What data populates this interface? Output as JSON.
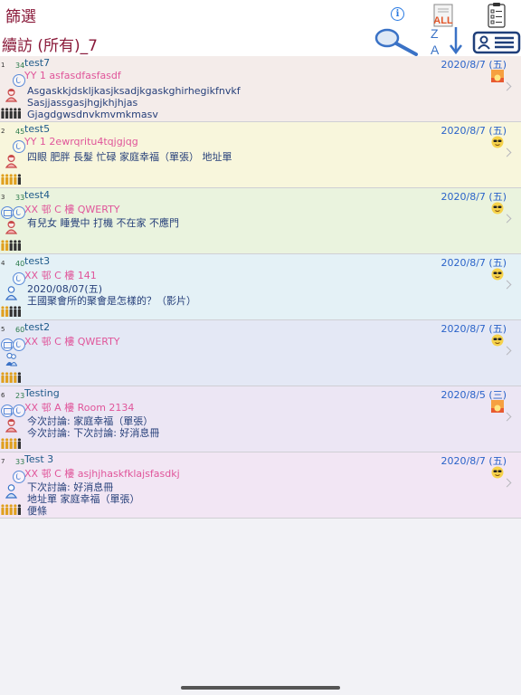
{
  "header": {
    "filter_label": "篩選",
    "title": "續訪 (所有)_7",
    "all_label": "ALL",
    "info_label": "i",
    "sort_letters": "Z A"
  },
  "colors": {
    "title": "#8a1a3a",
    "date": "#2a63c9",
    "address": "#e0559a",
    "notes": "#27407a"
  },
  "rows": [
    {
      "index": "1",
      "count": "34",
      "name": "test7",
      "date": "2020/8/7 (五)",
      "address": "YY 1 asfasdfasfasdf",
      "notes": [
        "Asgaskkjdskljkasjksadjkgaskghirhegikfnvkf",
        "Sasjjassgasjhgjkhjhjas",
        "Gjagdgwsdnvkmvmkmasv"
      ],
      "bg": "#f4ecea",
      "status_icon": "sunrise-icon",
      "contact": "phone",
      "person": "female",
      "people": "dark"
    },
    {
      "index": "2",
      "count": "45",
      "name": "test5",
      "date": "2020/8/7 (五)",
      "address": "YY 1 2ewrqritu4tqjgjqg",
      "notes": [
        "四眼 肥胖 長髮 忙碌 家庭幸福（單張） 地址單"
      ],
      "bg": "#f8f6dc",
      "status_icon": "sunglasses-icon",
      "contact": "phone",
      "person": "female",
      "people": "gold"
    },
    {
      "index": "3",
      "count": "33",
      "name": "test4",
      "date": "2020/8/7 (五)",
      "address": "XX 邨 C 樓 QWERTY",
      "notes": [
        "有兒女 睡覺中 打機 不在家 不應門"
      ],
      "bg": "#eaf3de",
      "status_icon": "sunglasses-icon",
      "contact": "both",
      "person": "female",
      "people": "mixed"
    },
    {
      "index": "4",
      "count": "40",
      "name": "test3",
      "date": "2020/8/7 (五)",
      "address": "XX 邨 C 樓 141",
      "notes": [
        "2020/08/07(五)",
        "王國聚會所的聚會是怎樣的？（影片）"
      ],
      "bg": "#e4f1f6",
      "status_icon": "sunglasses-icon",
      "contact": "phone",
      "person": "male",
      "people": "mixed"
    },
    {
      "index": "5",
      "count": "60",
      "name": "test2",
      "date": "2020/8/7 (五)",
      "address": "XX 邨 C 樓 QWERTY",
      "notes": [],
      "bg": "#e4e8f5",
      "status_icon": "sunglasses-icon",
      "contact": "both",
      "person": "couple",
      "people": "gold"
    },
    {
      "index": "6",
      "count": "23",
      "name": "Testing",
      "date": "2020/8/5 (三)",
      "address": "XX 邨 A 樓 Room 2134",
      "notes": [
        "今次討論: 家庭幸福（單張）",
        "今次討論: 下次討論: 好消息冊"
      ],
      "bg": "#ece6f4",
      "status_icon": "sunrise-icon",
      "contact": "both",
      "person": "female",
      "people": "gold"
    },
    {
      "index": "7",
      "count": "33",
      "name": "Test 3",
      "date": "2020/8/7 (五)",
      "address": "XX 邨 C 樓 asjhjhaskfklajsfasdkj",
      "notes": [
        "下次討論: 好消息冊",
        "地址單 家庭幸福（單張）",
        "便條"
      ],
      "bg": "#f2e6f4",
      "status_icon": "sunglasses-icon",
      "contact": "phone",
      "person": "male",
      "people": "gold"
    }
  ]
}
